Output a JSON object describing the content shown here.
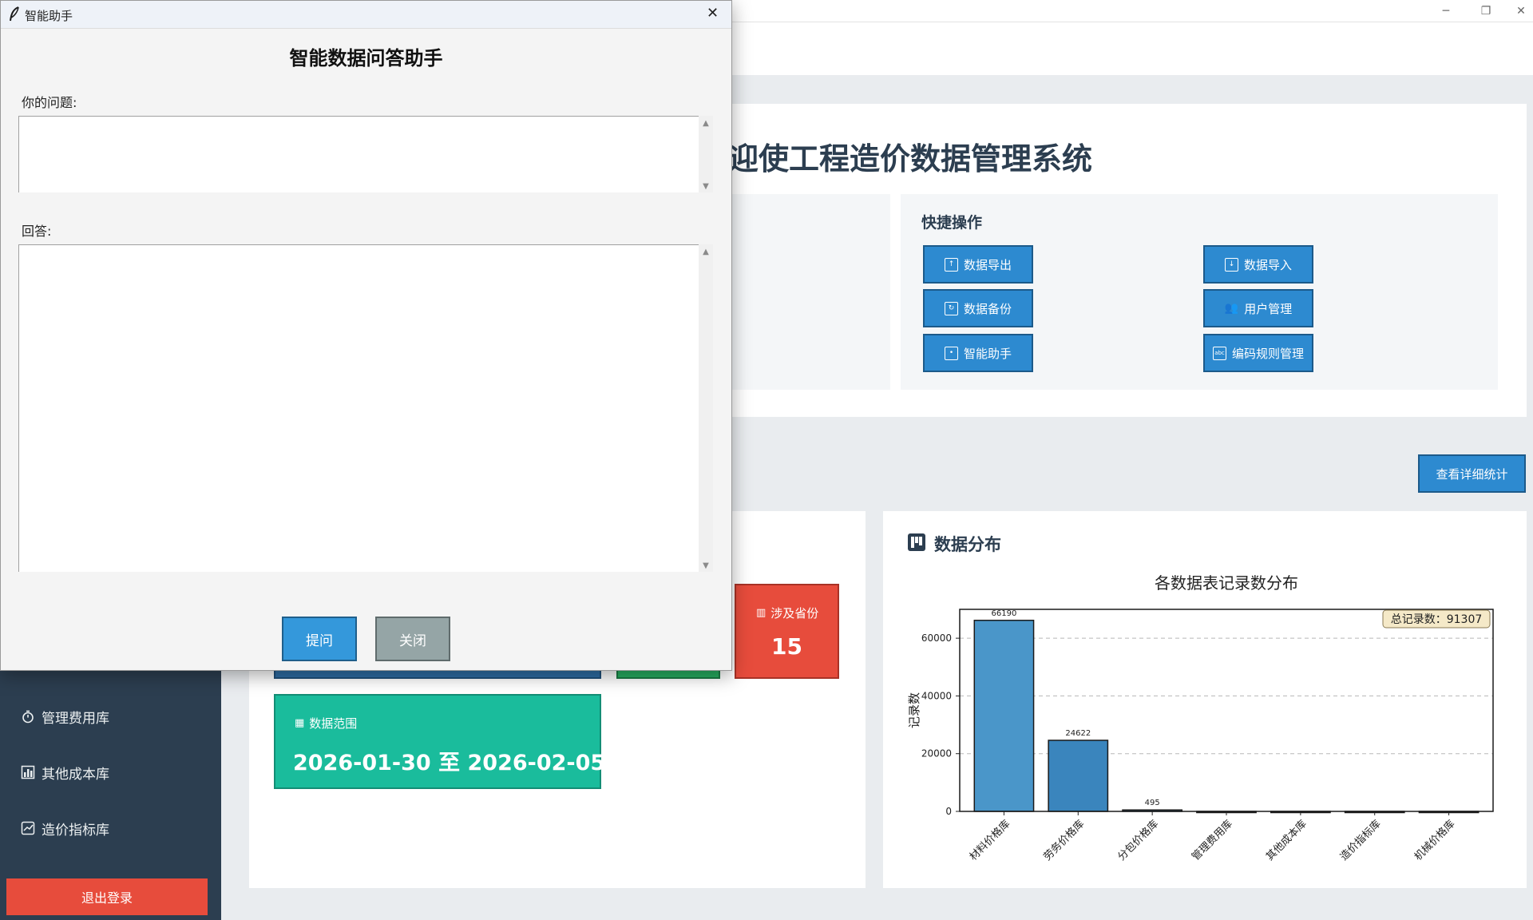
{
  "window": {
    "minimize_icon": "minimize",
    "restore_icon": "restore",
    "close_icon": "close"
  },
  "main": {
    "welcome_title": "迎使工程造价数据管理系统"
  },
  "quick_actions": {
    "title": "快捷操作",
    "buttons": [
      {
        "label": "数据导出",
        "icon": "export-icon"
      },
      {
        "label": "数据导入",
        "icon": "import-icon"
      },
      {
        "label": "数据备份",
        "icon": "backup-icon"
      },
      {
        "label": "用户管理",
        "icon": "users-icon"
      },
      {
        "label": "智能助手",
        "icon": "robot-icon"
      },
      {
        "label": "编码规则管理",
        "icon": "code-icon"
      }
    ]
  },
  "stats": {
    "detail_button": "查看详细统计",
    "provinces": {
      "label": "涉及省份",
      "value": "15"
    },
    "date_range": {
      "label": "数据范围",
      "value": "2026-01-30 至 2026-02-05"
    }
  },
  "sidebar": {
    "items": [
      {
        "label": "管理费用库",
        "icon": "stopwatch-icon"
      },
      {
        "label": "其他成本库",
        "icon": "bar-chart-icon"
      },
      {
        "label": "造价指标库",
        "icon": "line-chart-icon"
      }
    ],
    "logout": "退出登录"
  },
  "chart_section": {
    "title": "数据分布"
  },
  "chart_data": {
    "type": "bar",
    "title": "各数据表记录数分布",
    "ylabel": "记录数",
    "xlabel": "",
    "categories": [
      "材料价格库",
      "劳务价格库",
      "分包价格库",
      "管理费用库",
      "其他成本库",
      "造价指标库",
      "机械价格库"
    ],
    "values": [
      66190,
      24622,
      495,
      0,
      0,
      0,
      0
    ],
    "value_labels": [
      "66190",
      "24622",
      "495",
      "",
      "",
      "",
      ""
    ],
    "ylim": [
      0,
      70000
    ],
    "yticks": [
      0,
      20000,
      40000,
      60000
    ],
    "grid": "horizontal dashed",
    "annotation": "总记录数：91307",
    "annotation_position": "top-right",
    "bar_colors": [
      "#4a96c9",
      "#3a85bd",
      "#2c6fa3",
      "#2c6fa3",
      "#2c6fa3",
      "#2c6fa3",
      "#2c6fa3"
    ]
  },
  "dialog": {
    "title": "智能助手",
    "heading": "智能数据问答助手",
    "question_label": "你的问题:",
    "question_value": "",
    "answer_label": "回答:",
    "answer_value": "",
    "ask_button": "提问",
    "close_button": "关闭"
  },
  "colors": {
    "sidebar_bg": "#2c3e50",
    "primary_button": "#2d8ad0",
    "danger": "#e74c3c",
    "teal": "#1abc9c",
    "dialog_ask": "#3498db",
    "dialog_close": "#95a5a6"
  }
}
